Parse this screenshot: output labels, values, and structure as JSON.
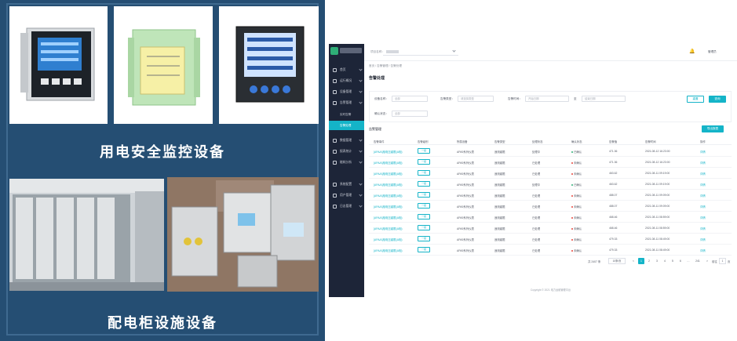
{
  "left_panel": {
    "caption_top": "用电安全监控设备",
    "caption_bottom": "配电柜设施设备"
  },
  "app": {
    "topbar": {
      "project_label": "项目名称：",
      "user_label": "管理员"
    },
    "sidebar": {
      "items": [
        {
          "label": "首页",
          "icon": "home-icon"
        },
        {
          "label": "运行概况",
          "icon": "dashboard-icon"
        },
        {
          "label": "设备管理",
          "icon": "device-icon"
        },
        {
          "label": "告警管理",
          "icon": "alarm-icon"
        }
      ],
      "subitems": [
        {
          "label": "实时告警",
          "active": false
        },
        {
          "label": "告警处理",
          "active": true
        }
      ],
      "items_after": [
        {
          "label": "数据管理",
          "icon": "data-icon"
        },
        {
          "label": "报表统计",
          "icon": "report-icon"
        },
        {
          "label": "能耗分析",
          "icon": "energy-icon"
        },
        {
          "label": "系统配置",
          "icon": "settings-icon"
        },
        {
          "label": "用户管理",
          "icon": "user-icon"
        },
        {
          "label": "日志管理",
          "icon": "log-icon"
        }
      ]
    },
    "breadcrumb": "首页 / 告警管理 / 告警处理",
    "page_title": "告警处理",
    "filters": {
      "device_label": "设备名称：",
      "device_placeholder": "全部",
      "type_label": "告警类型：",
      "type_placeholder": "请选择类型",
      "time_label": "告警时间：",
      "start_placeholder": "开始日期",
      "range_sep": "至",
      "end_placeholder": "结束日期",
      "confirm_label": "确认状态：",
      "confirm_placeholder": "全部",
      "reset": "重置",
      "query": "查询"
    },
    "table": {
      "title": "告警管理",
      "export": "导出报表",
      "columns": [
        "告警事件",
        "告警级别",
        "所属设备",
        "告警类型",
        "处理状态",
        "确认状态",
        "告警值",
        "告警时间",
        "操作"
      ],
      "rows": [
        {
          "event": "[APA/A]相电压越限(A相)",
          "level": "一级",
          "device": "APA9系列仪表",
          "type": "遥测越限",
          "status": "处理中",
          "confirm": "已确认",
          "confirm_color": "#2fae77",
          "value": "471.36",
          "time": "2021-08-12 16:23:00",
          "op": "详情"
        },
        {
          "event": "[APA/A]相电压越限(A相)",
          "level": "一级",
          "device": "APA9系列仪表",
          "type": "遥测越限",
          "status": "已处理",
          "confirm": "未确认",
          "confirm_color": "#e8453c",
          "value": "471.36",
          "time": "2021-08-12 16:23:00",
          "op": "详情"
        },
        {
          "event": "[APA/A]相电压越限(A相)",
          "level": "一级",
          "device": "APA9系列仪表",
          "type": "遥测越限",
          "status": "已处理",
          "confirm": "未确认",
          "confirm_color": "#e8453c",
          "value": "463.62",
          "time": "2021-08-11 09:19:00",
          "op": "详情"
        },
        {
          "event": "[APA/A]相电压越限(A相)",
          "level": "一级",
          "device": "APA9系列仪表",
          "type": "遥测越限",
          "status": "处理中",
          "confirm": "已确认",
          "confirm_color": "#2fae77",
          "value": "463.62",
          "time": "2021-08-11 09:19:00",
          "op": "详情"
        },
        {
          "event": "[APA/A]相电压越限(A相)",
          "level": "一级",
          "device": "APA9系列仪表",
          "type": "遥测越限",
          "status": "已处理",
          "confirm": "未确认",
          "confirm_color": "#e8453c",
          "value": "488.07",
          "time": "2021-08-11 09:09:00",
          "op": "详情"
        },
        {
          "event": "[APA/A]相电压越限(A相)",
          "level": "一级",
          "device": "APA9系列仪表",
          "type": "遥测越限",
          "status": "已处理",
          "confirm": "未确认",
          "confirm_color": "#e8453c",
          "value": "488.07",
          "time": "2021-08-11 09:09:00",
          "op": "详情"
        },
        {
          "event": "[APA/A]相电压越限(A相)",
          "level": "一级",
          "device": "APA9系列仪表",
          "type": "遥测越限",
          "status": "已处理",
          "confirm": "未确认",
          "confirm_color": "#e8453c",
          "value": "468.46",
          "time": "2021-08-11 08:59:00",
          "op": "详情"
        },
        {
          "event": "[APA/A]相电压越限(A相)",
          "level": "一级",
          "device": "APA9系列仪表",
          "type": "遥测越限",
          "status": "已处理",
          "confirm": "未确认",
          "confirm_color": "#e8453c",
          "value": "468.46",
          "time": "2021-08-11 08:59:00",
          "op": "详情"
        },
        {
          "event": "[APA/A]相电压越限(A相)",
          "level": "一级",
          "device": "APA9系列仪表",
          "type": "遥测越限",
          "status": "已处理",
          "confirm": "未确认",
          "confirm_color": "#e8453c",
          "value": "479.33",
          "time": "2021-08-11 08:49:00",
          "op": "详情"
        },
        {
          "event": "[APA/A]相电压越限(A相)",
          "level": "一级",
          "device": "APA9系列仪表",
          "type": "遥测越限",
          "status": "已处理",
          "confirm": "未确认",
          "confirm_color": "#e8453c",
          "value": "479.33",
          "time": "2021-08-11 08:49:00",
          "op": "详情"
        }
      ]
    },
    "pagination": {
      "total": "共 2407 条",
      "page_size": "10条/页",
      "prev": "<",
      "pages": [
        "1",
        "2",
        "3",
        "4",
        "5",
        "6"
      ],
      "active_page": "1",
      "ellipsis": "…",
      "last": "241",
      "next": ">",
      "goto_label": "前往",
      "goto_value": "1",
      "page_unit": "页"
    },
    "footer": "Copyright © 2021 电力运维管理平台"
  }
}
